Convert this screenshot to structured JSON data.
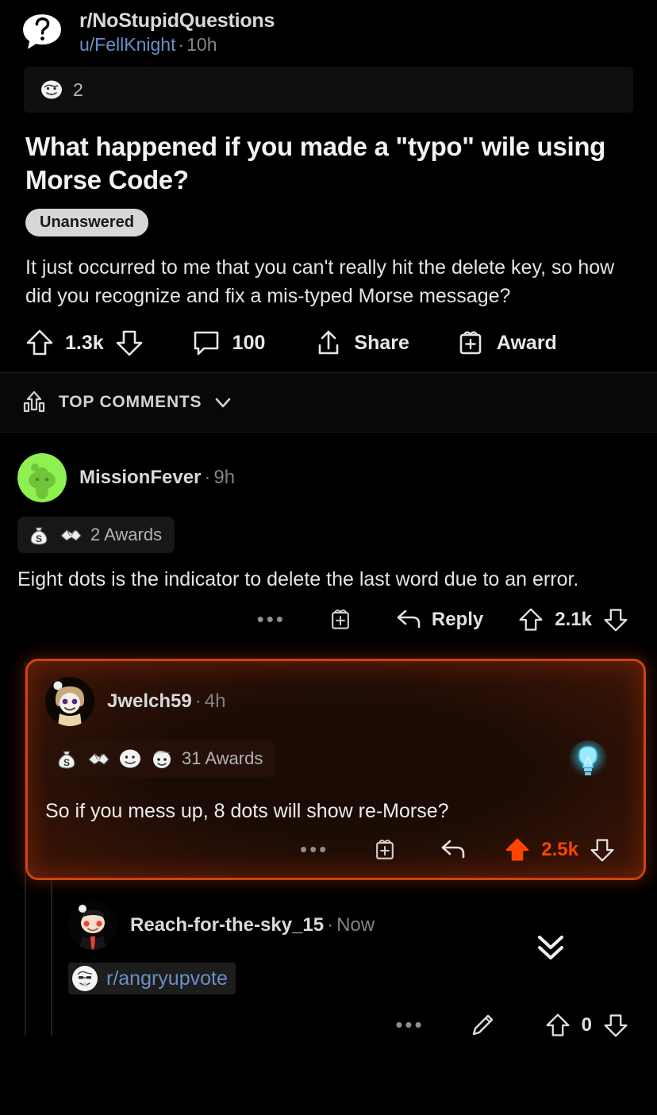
{
  "post": {
    "subreddit": "r/NoStupidQuestions",
    "author": "u/FellKnight",
    "dot": "·",
    "time": "10h",
    "subreddit_icon": "question-speech-bubble-icon",
    "award_count": "2",
    "title": "What happened if you made a \"typo\" wile using Morse Code?",
    "flair": "Unanswered",
    "body": "It just occurred to me that you can't really hit the delete key, so how did you recognize and fix a mis-typed Morse message?",
    "actions": {
      "upvote_icon": "upvote-arrow-icon",
      "score": "1.3k",
      "downvote_icon": "downvote-arrow-icon",
      "comment_icon": "comment-bubble-icon",
      "comment_count": "100",
      "share_icon": "share-icon",
      "share_label": "Share",
      "award_icon": "award-gift-icon",
      "award_label": "Award"
    }
  },
  "sort_bar": {
    "icon": "sort-top-icon",
    "label": "TOP COMMENTS",
    "chevron": "chevron-down-icon"
  },
  "comments": [
    {
      "author": "MissionFever",
      "dot": "·",
      "time": "9h",
      "avatar": "green-snoo-avatar",
      "awards_label": "2 Awards",
      "award_icons": [
        "money-bag-award-icon",
        "handshake-award-icon"
      ],
      "text": "Eight dots is the indicator to delete the last word due to an error.",
      "actions": {
        "more_icon": "more-dots-icon",
        "award_icon": "award-gift-icon",
        "reply_icon": "reply-arrow-icon",
        "reply_label": "Reply",
        "upvote_icon": "upvote-arrow-icon",
        "score": "2.1k",
        "downvote_icon": "downvote-arrow-icon"
      }
    },
    {
      "author": "Jwelch59",
      "dot": "·",
      "time": "4h",
      "avatar": "hooded-snoo-avatar",
      "highlighted": true,
      "awards_label": "31 Awards",
      "award_icons": [
        "money-bag-award-icon",
        "handshake-award-icon",
        "table-flip-award-icon",
        "helpful-award-icon"
      ],
      "badge_icon": "glowing-lightbulb-icon",
      "text": "So if you mess up, 8 dots will show re-Morse?",
      "actions": {
        "more_icon": "more-dots-icon",
        "award_icon": "award-gift-icon",
        "reply_icon": "reply-arrow-icon",
        "upvote_icon": "upvote-arrow-filled-icon",
        "score": "2.5k",
        "downvote_icon": "downvote-arrow-icon"
      }
    },
    {
      "author": "Reach-for-the-sky_15",
      "dot": "·",
      "time": "Now",
      "avatar": "suit-snoo-avatar",
      "link_icon": "angryupvote-subreddit-icon",
      "link_text": "r/angryupvote",
      "collapse_icon": "double-chevron-down-icon",
      "actions": {
        "more_icon": "more-dots-icon",
        "edit_icon": "pencil-edit-icon",
        "upvote_icon": "upvote-arrow-icon",
        "score": "0",
        "downvote_icon": "downvote-arrow-icon"
      }
    }
  ],
  "colors": {
    "background": "#000000",
    "highlight_border": "#d0430f",
    "highlight_bg": "#1a0b05",
    "upvote_orange": "#ff4500",
    "link_blue": "#6a8fc7",
    "muted_text": "#818384"
  }
}
